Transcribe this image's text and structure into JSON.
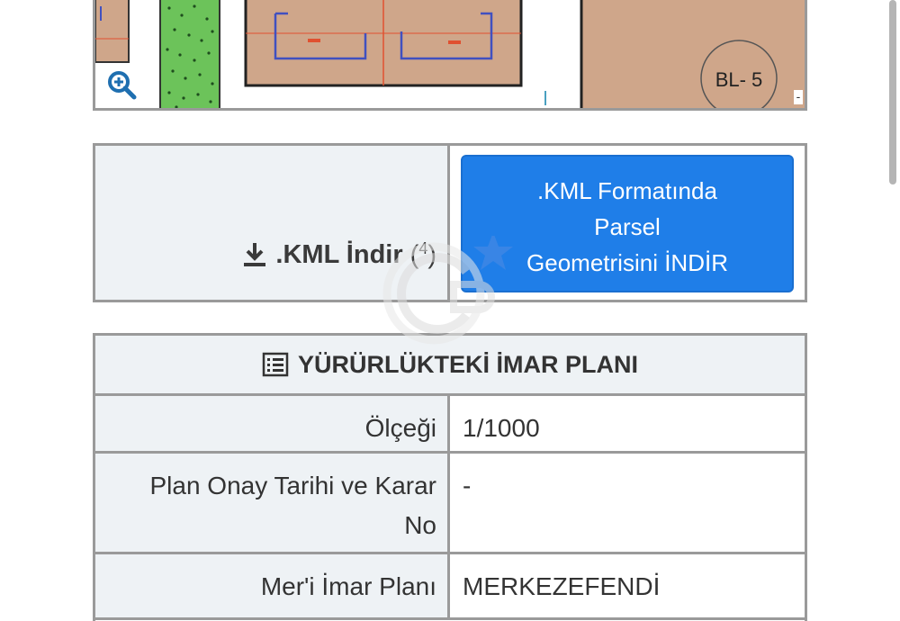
{
  "map": {
    "block_label": "BL- 5",
    "zoom_icon": "zoom-in-icon",
    "edge_symbol": "-"
  },
  "kml": {
    "label": ".KML İndir",
    "label_sup": "4",
    "label_paren_open": "(",
    "label_paren_close": ")",
    "download_icon": "download-icon",
    "button_lines": [
      ".KML Formatında",
      "Parsel",
      "Geometrisini İNDİR"
    ]
  },
  "plan": {
    "header": "YÜRÜRLÜKTEKİ İMAR PLANI",
    "header_icon": "list-icon",
    "rows": [
      {
        "key": "Ölçeği",
        "value": "1/1000"
      },
      {
        "key": "Plan Onay Tarihi ve Karar No",
        "value": "-"
      },
      {
        "key": "Mer'i İmar Planı",
        "value": "MERKEZEFENDİ"
      }
    ]
  },
  "colors": {
    "primary": "#1f7ee8",
    "cell_bg": "#eef2f5",
    "border": "#9a9a9a",
    "parcel": "#cfa68a",
    "green_area": "#6cc35a"
  }
}
